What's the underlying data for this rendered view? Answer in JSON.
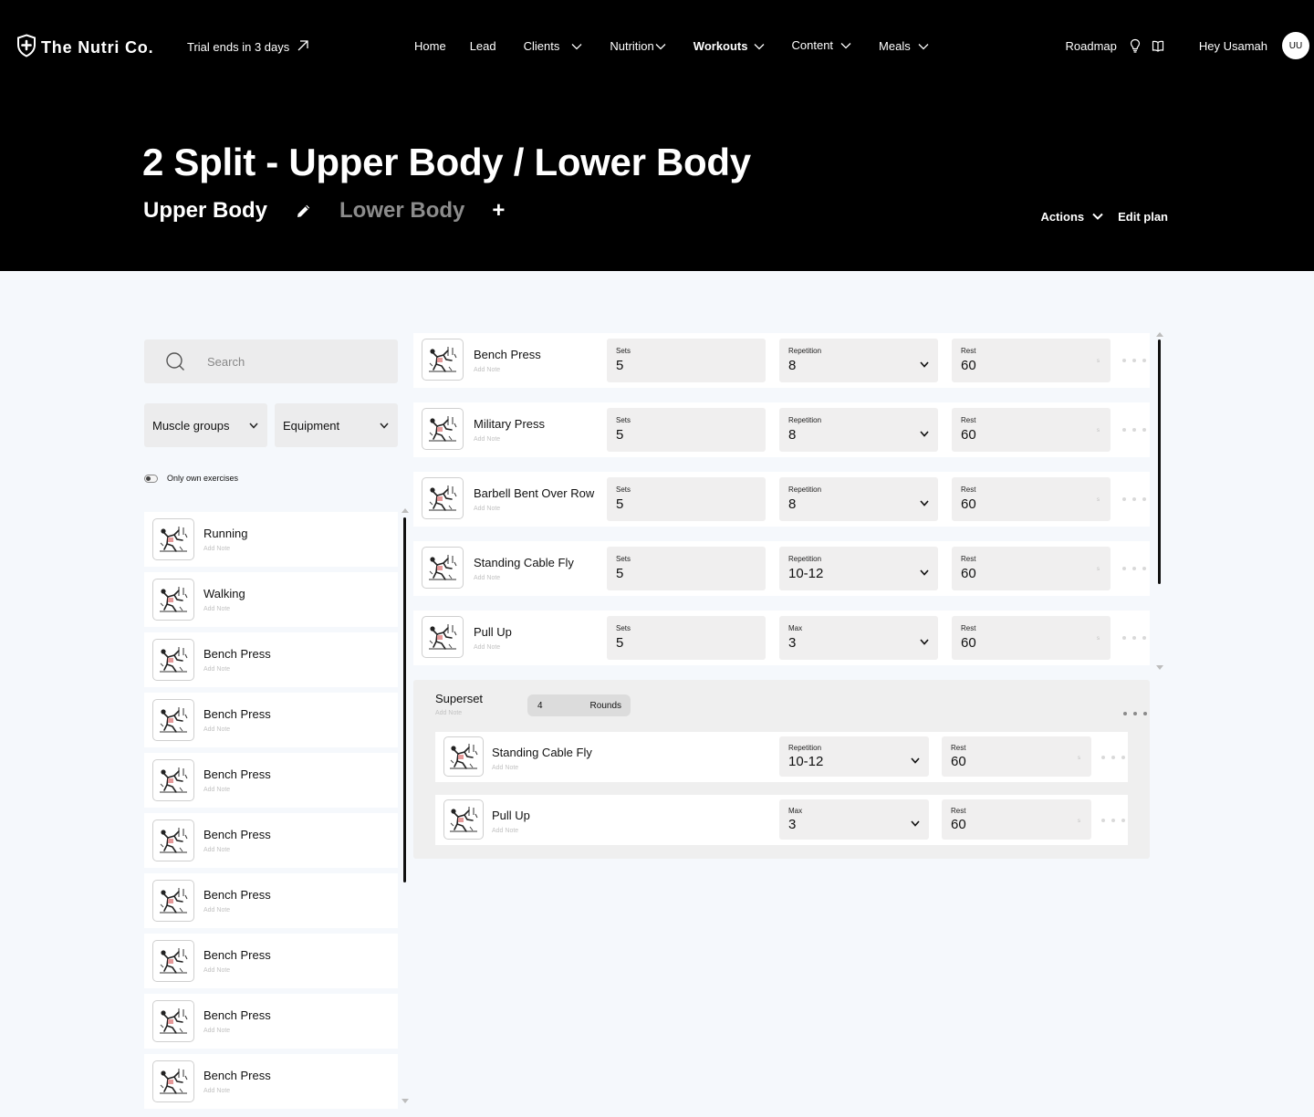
{
  "header": {
    "logo_text": "The Nutri Co.",
    "trial_text": "Trial ends in 3 days",
    "nav": [
      {
        "label": "Home",
        "bold": false,
        "chevron": false
      },
      {
        "label": "Lead",
        "bold": false,
        "chevron": false
      },
      {
        "label": "Clients",
        "bold": false,
        "chevron": true
      },
      {
        "label": "Nutrition",
        "bold": false,
        "chevron": true
      },
      {
        "label": "Workouts",
        "bold": true,
        "chevron": true
      },
      {
        "label": "Content",
        "bold": false,
        "chevron": true
      },
      {
        "label": "Meals",
        "bold": false,
        "chevron": true
      }
    ],
    "roadmap_label": "Roadmap",
    "greeting": "Hey Usamah",
    "avatar_initials": "UU"
  },
  "plan": {
    "title": "2 Split - Upper Body / Lower Body",
    "days": [
      {
        "label": "Upper Body",
        "active": true
      },
      {
        "label": "Lower Body",
        "active": false
      }
    ],
    "add_day_label": "+",
    "actions_label": "Actions",
    "edit_label": "Edit plan"
  },
  "library": {
    "search_placeholder": "Search",
    "filter_muscle": "Muscle groups",
    "filter_equipment": "Equipment",
    "own_exercises_label": "Only own exercises",
    "own_exercises_on": false,
    "items": [
      {
        "name": "Running",
        "note": "Add Note"
      },
      {
        "name": "Walking",
        "note": "Add Note"
      },
      {
        "name": "Bench Press",
        "note": "Add Note"
      },
      {
        "name": "Bench Press",
        "note": "Add Note"
      },
      {
        "name": "Bench Press",
        "note": "Add Note"
      },
      {
        "name": "Bench Press",
        "note": "Add Note"
      },
      {
        "name": "Bench Press",
        "note": "Add Note"
      },
      {
        "name": "Bench Press",
        "note": "Add Note"
      },
      {
        "name": "Bench Press",
        "note": "Add Note"
      },
      {
        "name": "Bench Press",
        "note": "Add Note"
      }
    ]
  },
  "workout": {
    "exercises": [
      {
        "name": "Bench Press",
        "note": "Add Note",
        "sets_label": "Sets",
        "sets": "5",
        "rep_label": "Repetition",
        "rep": "8",
        "rest_label": "Rest",
        "rest": "60",
        "rest_unit": "s"
      },
      {
        "name": "Military Press",
        "note": "Add Note",
        "sets_label": "Sets",
        "sets": "5",
        "rep_label": "Repetition",
        "rep": "8",
        "rest_label": "Rest",
        "rest": "60",
        "rest_unit": "s"
      },
      {
        "name": "Barbell Bent Over Row",
        "note": "Add Note",
        "sets_label": "Sets",
        "sets": "5",
        "rep_label": "Repetition",
        "rep": "8",
        "rest_label": "Rest",
        "rest": "60",
        "rest_unit": "s"
      },
      {
        "name": "Standing Cable Fly",
        "note": "Add Note",
        "sets_label": "Sets",
        "sets": "5",
        "rep_label": "Repetition",
        "rep": "10-12",
        "rest_label": "Rest",
        "rest": "60",
        "rest_unit": "s"
      },
      {
        "name": "Pull Up",
        "note": "Add Note",
        "sets_label": "Sets",
        "sets": "5",
        "rep_label": "Max",
        "rep": "3",
        "rest_label": "Rest",
        "rest": "60",
        "rest_unit": "s"
      }
    ],
    "superset": {
      "title": "Superset",
      "note": "Add Note",
      "rounds_value": "4",
      "rounds_label": "Rounds",
      "exercises": [
        {
          "name": "Standing Cable Fly",
          "note": "Add Note",
          "rep_label": "Repetition",
          "rep": "10-12",
          "rest_label": "Rest",
          "rest": "60",
          "rest_unit": "s"
        },
        {
          "name": "Pull Up",
          "note": "Add Note",
          "rep_label": "Max",
          "rep": "3",
          "rest_label": "Rest",
          "rest": "60",
          "rest_unit": "s"
        }
      ]
    }
  },
  "icons": {
    "logo": "shield-plus-icon",
    "trial": "arrow-up-right-icon",
    "roadmap": [
      "lightbulb-icon",
      "book-icon"
    ],
    "edit_day": "pencil-icon",
    "search": "search-icon",
    "exercise_thumb": "exercise-illustration-icon"
  },
  "colors": {
    "header_bg": "#000000",
    "page_bg": "#f5f8fc",
    "field_bg": "#f0efef",
    "inactive_tab": "#8c8c8c"
  }
}
